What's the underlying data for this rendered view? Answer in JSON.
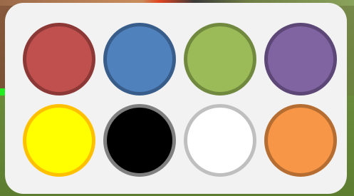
{
  "palette": {
    "swatches": [
      {
        "name": "red",
        "fill": "#c0504d",
        "border": "#8c3836"
      },
      {
        "name": "blue",
        "fill": "#4f81bd",
        "border": "#385d8a"
      },
      {
        "name": "green",
        "fill": "#9bbb59",
        "border": "#71893f"
      },
      {
        "name": "purple",
        "fill": "#8064a2",
        "border": "#5c4776"
      },
      {
        "name": "yellow",
        "fill": "#ffff00",
        "border": "#ffc000"
      },
      {
        "name": "black",
        "fill": "#000000",
        "border": "#7f7f7f"
      },
      {
        "name": "white",
        "fill": "#ffffff",
        "border": "#bfbfbf"
      },
      {
        "name": "orange",
        "fill": "#f79646",
        "border": "#b66d31"
      }
    ]
  }
}
